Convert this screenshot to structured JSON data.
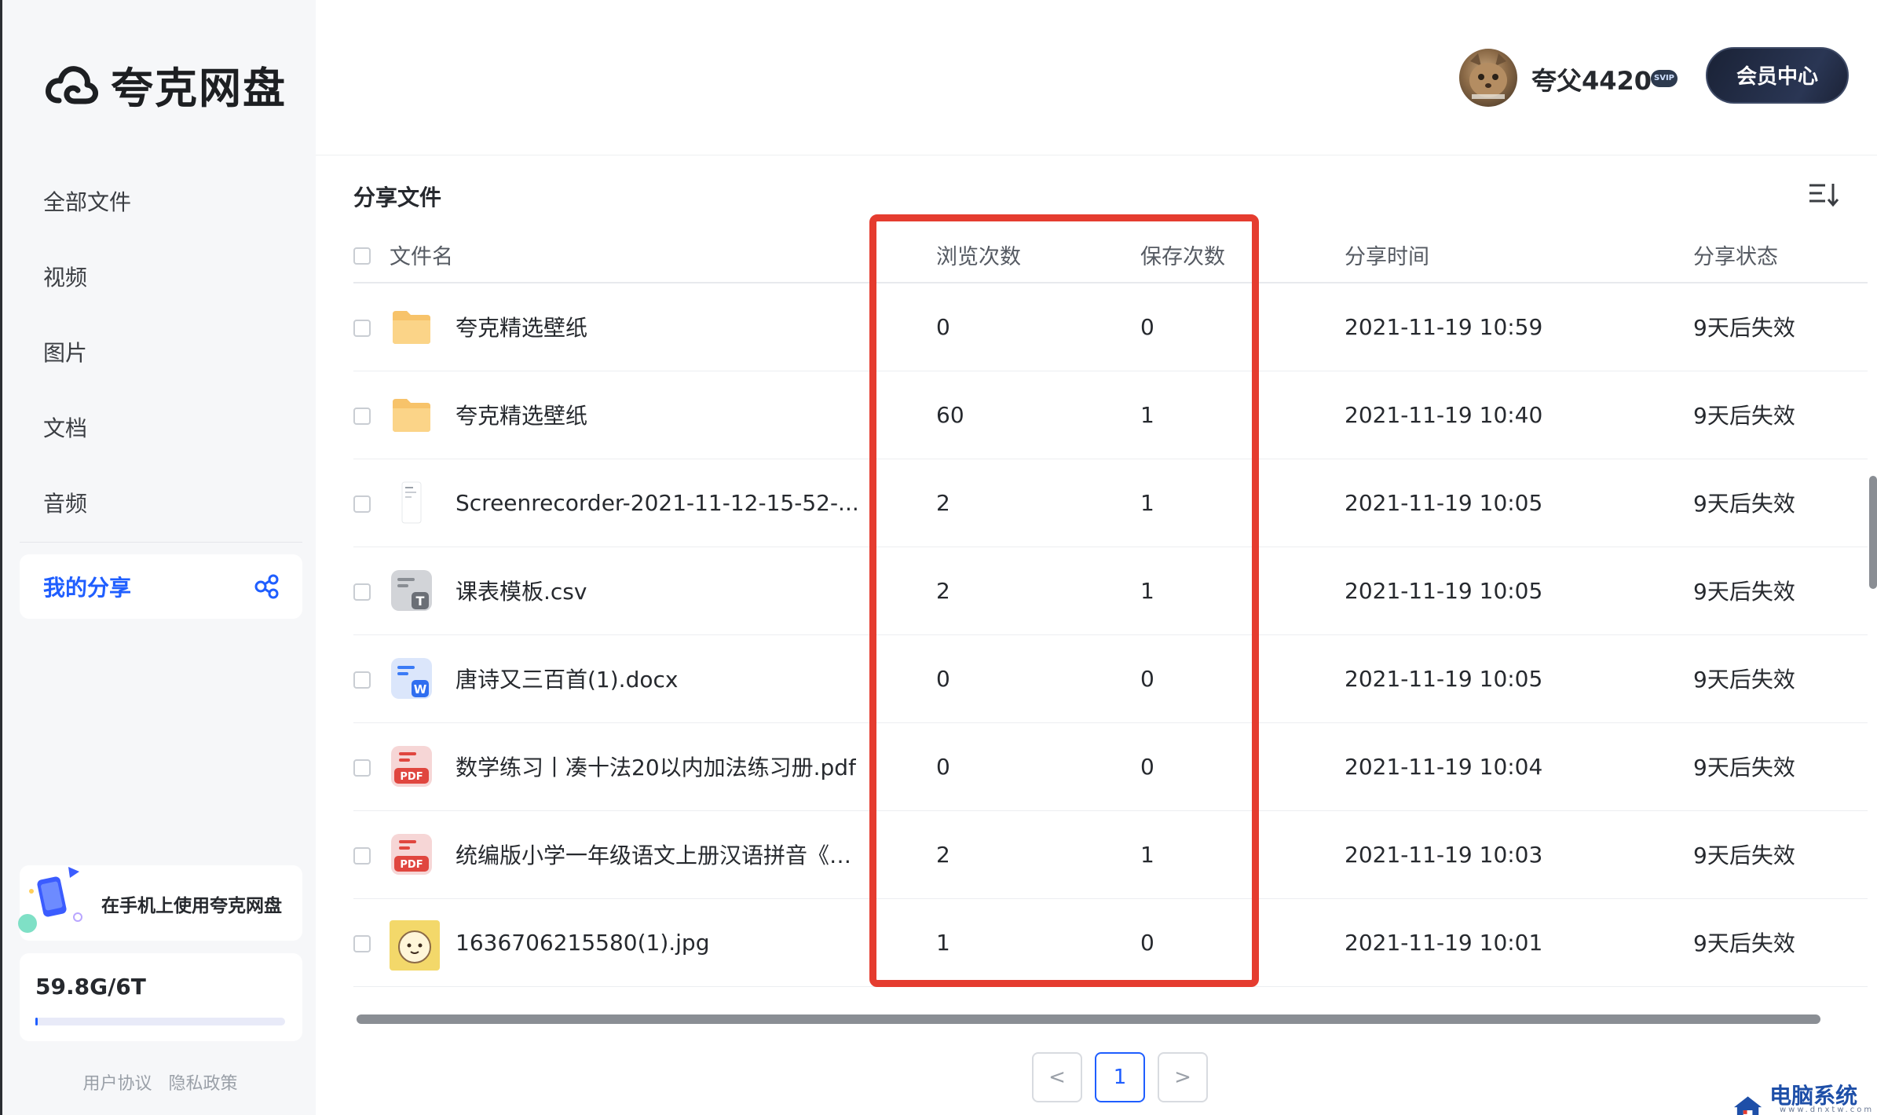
{
  "app": {
    "name": "夸克网盘"
  },
  "sidebar": {
    "items": [
      {
        "label": "全部文件"
      },
      {
        "label": "视频"
      },
      {
        "label": "图片"
      },
      {
        "label": "文档"
      },
      {
        "label": "音频"
      }
    ],
    "active_label": "我的分享",
    "promo_text": "在手机上使用夸克网盘",
    "storage_text": "59.8G/6T",
    "storage_used_fraction": 0.01,
    "footer_links": [
      "用户协议",
      "隐私政策"
    ]
  },
  "header": {
    "user_name": "夸父4420",
    "badge": "SVIP",
    "vip_button": "会员中心"
  },
  "main": {
    "title": "分享文件",
    "columns": {
      "name": "文件名",
      "views": "浏览次数",
      "saves": "保存次数",
      "time": "分享时间",
      "status": "分享状态"
    },
    "rows": [
      {
        "icon": "folder",
        "name": "夸克精选壁纸",
        "views": "0",
        "saves": "0",
        "time": "2021-11-19 10:59",
        "status": "9天后失效"
      },
      {
        "icon": "folder",
        "name": "夸克精选壁纸",
        "views": "60",
        "saves": "1",
        "time": "2021-11-19 10:40",
        "status": "9天后失效"
      },
      {
        "icon": "video-thumb",
        "name": "Screenrecorder-2021-11-12-15-52-...",
        "views": "2",
        "saves": "1",
        "time": "2021-11-19 10:05",
        "status": "9天后失效"
      },
      {
        "icon": "csv",
        "name": "课表模板.csv",
        "views": "2",
        "saves": "1",
        "time": "2021-11-19 10:05",
        "status": "9天后失效"
      },
      {
        "icon": "word",
        "name": "唐诗又三百首(1).docx",
        "views": "0",
        "saves": "0",
        "time": "2021-11-19 10:05",
        "status": "9天后失效"
      },
      {
        "icon": "pdf",
        "name": "数学练习丨凑十法20以内加法练习册.pdf",
        "views": "0",
        "saves": "0",
        "time": "2021-11-19 10:04",
        "status": "9天后失效"
      },
      {
        "icon": "pdf",
        "name": "统编版小学一年级语文上册汉语拼音《d...",
        "views": "2",
        "saves": "1",
        "time": "2021-11-19 10:03",
        "status": "9天后失效"
      },
      {
        "icon": "image",
        "name": "1636706215580(1).jpg",
        "views": "1",
        "saves": "0",
        "time": "2021-11-19 10:01",
        "status": "9天后失效"
      }
    ]
  },
  "pagination": {
    "prev": "<",
    "current": "1",
    "next": ">"
  },
  "watermark": {
    "text": "电脑系统网",
    "sub": "www.dnxtw.com"
  },
  "colors": {
    "accent": "#1f5eff",
    "highlight": "#e53c2f",
    "vip_bg": "#1a2236"
  }
}
